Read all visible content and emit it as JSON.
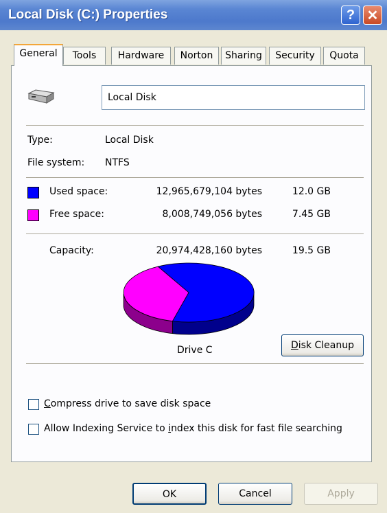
{
  "window": {
    "title": "Local Disk (C:) Properties",
    "help_label": "?",
    "close_label": "✕"
  },
  "tabs": [
    "General",
    "Tools",
    "Hardware",
    "Norton",
    "Sharing",
    "Security",
    "Quota"
  ],
  "active_tab": "General",
  "general": {
    "drive_name": "Local Disk",
    "type_label": "Type:",
    "type_value": "Local Disk",
    "fs_label": "File system:",
    "fs_value": "NTFS",
    "used_label": "Used space:",
    "used_bytes": "12,965,679,104 bytes",
    "used_gb": "12.0 GB",
    "free_label": "Free space:",
    "free_bytes": "8,008,749,056 bytes",
    "free_gb": "7.45 GB",
    "capacity_label": "Capacity:",
    "capacity_bytes": "20,974,428,160 bytes",
    "capacity_gb": "19.5 GB",
    "drive_label": "Drive C",
    "disk_cleanup_prefix": "D",
    "disk_cleanup_rest": "isk Cleanup",
    "compress_prefix": "C",
    "compress_rest": "ompress drive to save disk space",
    "index_before": "Allow Indexing Service to ",
    "index_key": "i",
    "index_after": "ndex this disk for fast file searching"
  },
  "chart_data": {
    "type": "pie",
    "slices": [
      {
        "name": "Used space",
        "value": 12965679104,
        "color": "#0000ff"
      },
      {
        "name": "Free space",
        "value": 8008749056,
        "color": "#ff00ff"
      }
    ]
  },
  "colors": {
    "used": "#0000ff",
    "free": "#ff00ff",
    "titlebar": "#4d79cc"
  },
  "buttons": {
    "ok": "OK",
    "cancel": "Cancel",
    "apply": "Apply"
  }
}
